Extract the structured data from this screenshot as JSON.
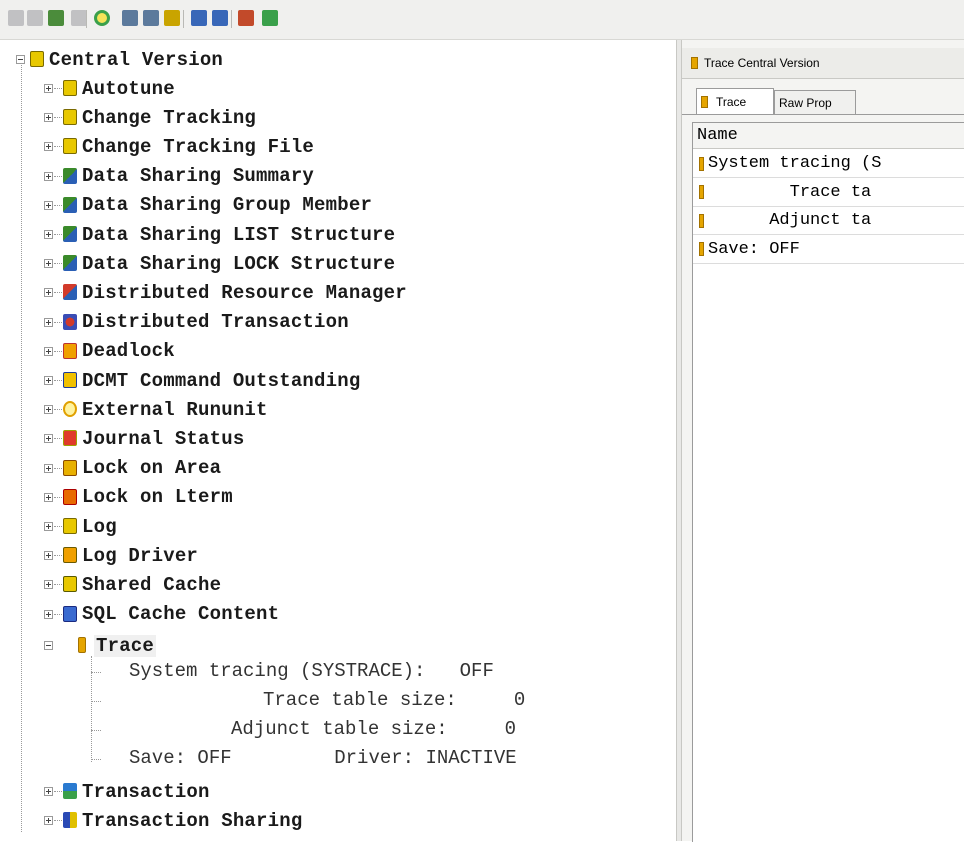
{
  "colors": {
    "accent_orange": "#e5a500",
    "tree_text": "#1a1a1a"
  },
  "toolbar": {
    "buttons": [
      "disabled-square-icon",
      "disabled-square-icon",
      "network-icon",
      "disabled-square-icon",
      "refresh-icon",
      "grid-icon",
      "grid-alt-icon",
      "tree-icon",
      "branch-icon",
      "branch-alt-icon",
      "hierarchy-icon",
      "hierarchy-alt-icon"
    ]
  },
  "tree": {
    "root": {
      "label": "Central Version"
    },
    "items": [
      {
        "label": "Autotune",
        "icon": "yellow-db-icon"
      },
      {
        "label": "Change Tracking",
        "icon": "yellow-db-icon"
      },
      {
        "label": "Change Tracking File",
        "icon": "yellow-db-icon"
      },
      {
        "label": "Data Sharing Summary",
        "icon": "data-sharing-icon"
      },
      {
        "label": "Data Sharing Group Member",
        "icon": "data-sharing-icon"
      },
      {
        "label": "Data Sharing LIST Structure",
        "icon": "data-sharing-icon"
      },
      {
        "label": "Data Sharing LOCK Structure",
        "icon": "data-sharing-icon"
      },
      {
        "label": "Distributed Resource Manager",
        "icon": "distributed-icon"
      },
      {
        "label": "Distributed Transaction",
        "icon": "distributed-txn-icon"
      },
      {
        "label": "Deadlock",
        "icon": "deadlock-icon"
      },
      {
        "label": "DCMT Command Outstanding",
        "icon": "command-icon"
      },
      {
        "label": "External Rununit",
        "icon": "external-icon"
      },
      {
        "label": "Journal Status",
        "icon": "journal-icon"
      },
      {
        "label": "Lock on Area",
        "icon": "lock-area-icon"
      },
      {
        "label": "Lock on Lterm",
        "icon": "lock-lterm-icon"
      },
      {
        "label": "Log",
        "icon": "log-icon"
      },
      {
        "label": "Log Driver",
        "icon": "log-driver-icon"
      },
      {
        "label": "Shared Cache",
        "icon": "shared-cache-icon"
      },
      {
        "label": "SQL Cache Content",
        "icon": "sql-cache-icon"
      }
    ],
    "trace": {
      "label": "Trace",
      "details": [
        "System tracing (SYSTRACE):   OFF",
        "Trace table size:     0",
        "Adjunct table size:     0",
        "Save: OFF         Driver: INACTIVE"
      ]
    },
    "after": [
      {
        "label": "Transaction",
        "icon": "transaction-icon"
      },
      {
        "label": "Transaction Sharing",
        "icon": "transaction-sharing-icon"
      }
    ]
  },
  "right_pane": {
    "title": "Trace Central Version",
    "tabs": [
      {
        "label": "Trace"
      },
      {
        "label": "Raw Prop"
      }
    ],
    "grid": {
      "header": "Name",
      "rows": [
        "System tracing (S",
        "        Trace ta",
        "      Adjunct ta",
        "Save: OFF"
      ]
    }
  }
}
